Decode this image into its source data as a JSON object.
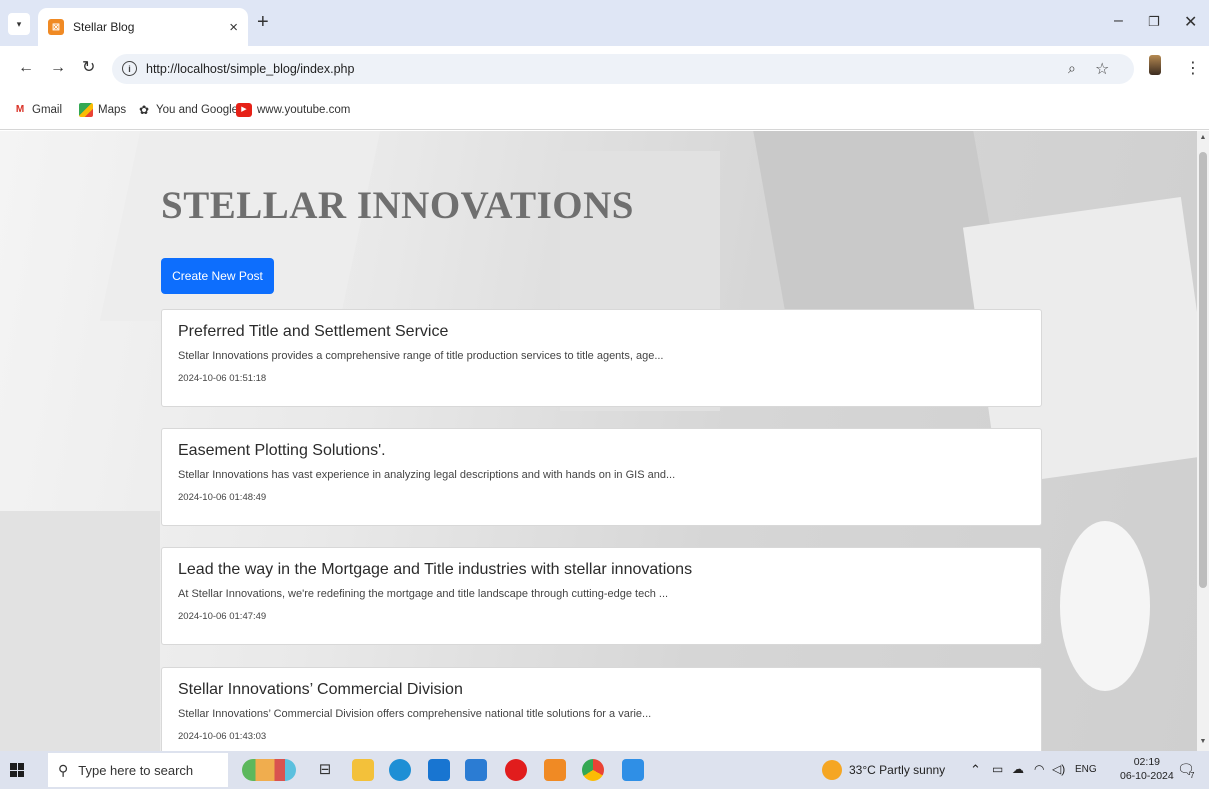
{
  "browser": {
    "tab_title": "Stellar Blog",
    "tab_close": "×",
    "new_tab": "+",
    "favicon": "⊠",
    "url": "http://localhost/simple_blog/index.php",
    "bookmarks": [
      {
        "label": "Gmail",
        "icon": "gmail-icon"
      },
      {
        "label": "Maps",
        "icon": "maps-icon"
      },
      {
        "label": "You and Google",
        "icon": "gear-icon"
      },
      {
        "label": "www.youtube.com",
        "icon": "youtube-icon"
      }
    ]
  },
  "page": {
    "site_title": "STELLAR INNOVATIONS",
    "create_button": "Create New Post",
    "posts": [
      {
        "title": "Preferred Title and Settlement Service",
        "excerpt": "Stellar Innovations provides a comprehensive range of title production services to title agents, age...",
        "date": "2024-10-06 01:51:18"
      },
      {
        "title": "Easement Plotting Solutions'.",
        "excerpt": "Stellar Innovations has vast experience in analyzing legal descriptions and with hands on in GIS and...",
        "date": "2024-10-06 01:48:49"
      },
      {
        "title": "Lead the way in the Mortgage and Title industries with stellar innovations",
        "excerpt": "At Stellar Innovations, we're redefining the mortgage and title landscape through cutting-edge tech ...",
        "date": "2024-10-06 01:47:49"
      },
      {
        "title": "Stellar Innovations’ Commercial Division",
        "excerpt": "Stellar Innovations’ Commercial Division offers comprehensive national title solutions for a varie...",
        "date": "2024-10-06 01:43:03"
      }
    ]
  },
  "taskbar": {
    "search_placeholder": "Type here to search",
    "weather": "33°C  Partly sunny",
    "language": "ENG",
    "time": "02:19",
    "date": "06-10-2024",
    "notifications": "7"
  },
  "colors": {
    "accent": "#0d6efd",
    "tabstrip": "#dfe6f5",
    "taskbar": "#dde2ee"
  }
}
